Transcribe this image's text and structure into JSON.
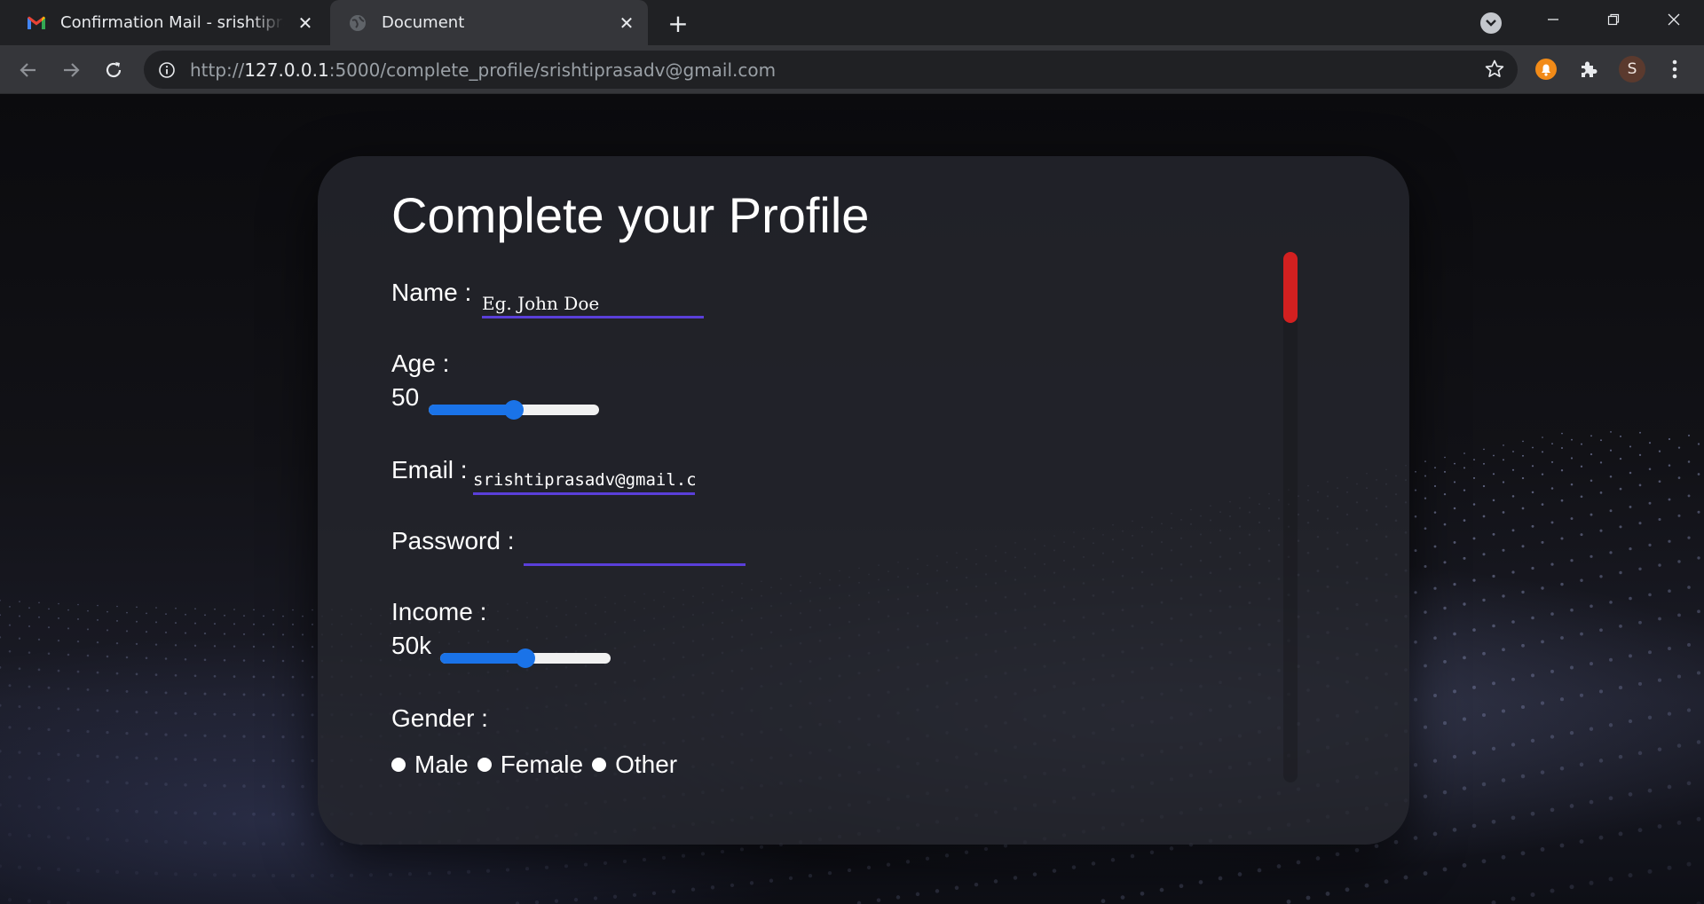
{
  "browser": {
    "tabs": [
      {
        "title": "Confirmation Mail - srishtiprasadv@gmail.com",
        "active": false,
        "icon": "gmail-icon"
      },
      {
        "title": "Document",
        "active": true,
        "icon": "globe-icon"
      }
    ],
    "new_tab_label": "+",
    "close_glyph": "✕",
    "url_scheme": "http://",
    "url_host": "127.0.0.1",
    "url_rest": ":5000/complete_profile/srishtiprasadv@gmail.com",
    "profile_initial": "S"
  },
  "form": {
    "title": "Complete your Profile",
    "name_label": "Name :",
    "name_placeholder": "Eg. John Doe",
    "age_label": "Age :",
    "age_value": "50",
    "age_fraction": 0.5,
    "email_label": "Email :",
    "email_value": "srishtiprasadv@gmail.com",
    "password_label": "Password :",
    "password_value": "",
    "income_label": "Income :",
    "income_value": "50k",
    "income_fraction": 0.5,
    "gender_label": "Gender :",
    "gender_options": [
      "Male",
      "Female",
      "Other"
    ]
  },
  "colors": {
    "accent_underline": "#5a3fd9",
    "slider": "#1a73e8",
    "scroll_thumb": "#d32020"
  }
}
